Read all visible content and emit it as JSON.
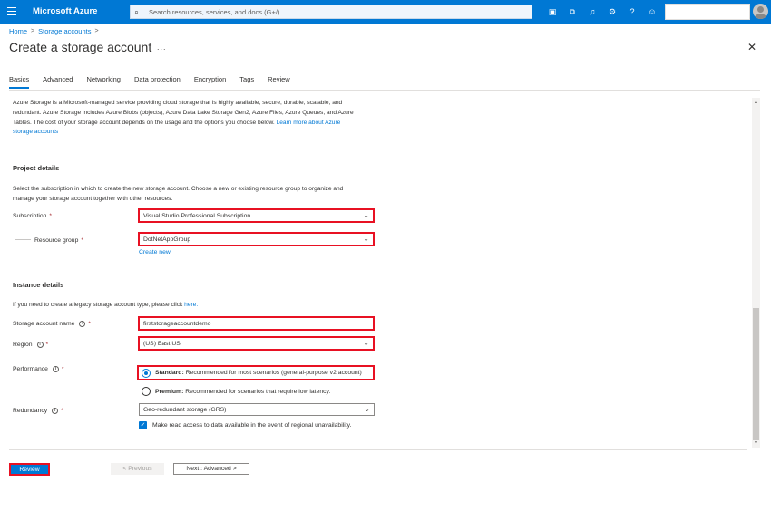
{
  "topbar": {
    "brand": "Microsoft Azure",
    "search_placeholder": "Search resources, services, and docs (G+/)",
    "icons": [
      "cloud-shell-icon",
      "directory-filter-icon",
      "bell-icon",
      "gear-icon",
      "help-icon",
      "feedback-icon"
    ]
  },
  "breadcrumb": {
    "home": "Home",
    "parent": "Storage accounts",
    "separator": ">"
  },
  "page": {
    "title": "Create a storage account",
    "more": "...",
    "close": "✕"
  },
  "tabs": [
    "Basics",
    "Advanced",
    "Networking",
    "Data protection",
    "Encryption",
    "Tags",
    "Review"
  ],
  "intro": {
    "line1": "Azure Storage is a Microsoft-managed service providing cloud storage that is highly available, secure, durable, scalable, and",
    "line2": "redundant. Azure Storage includes Azure Blobs (objects), Azure Data Lake Storage Gen2, Azure Files, Azure Queues, and Azure",
    "line3": "Tables. The cost of your storage account depends on the usage and the options you choose below.",
    "link_part1": "Learn more about Azure",
    "link_part2": "storage accounts"
  },
  "project": {
    "heading": "Project details",
    "desc1": "Select the subscription in which to create the new storage account. Choose a new or existing resource group to organize and",
    "desc2": "manage your storage account together with other resources.",
    "subscription_label": "Subscription",
    "subscription_value": "Visual Studio Professional Subscription",
    "rg_label": "Resource group",
    "rg_value": "DotNetAppGroup",
    "create_new": "Create new"
  },
  "instance": {
    "heading": "Instance details",
    "legacy_text": "If you need to create a legacy storage account type, please click",
    "legacy_link": "here.",
    "name_label": "Storage account name",
    "name_value": "firststorageaccountdemo",
    "region_label": "Region",
    "region_value": "(US) East US",
    "performance_label": "Performance",
    "standard_bold": "Standard:",
    "standard_text": "Recommended for most scenarios (general-purpose v2 account)",
    "premium_bold": "Premium:",
    "premium_text": "Recommended for scenarios that require low latency.",
    "redundancy_label": "Redundancy",
    "redundancy_value": "Geo-redundant storage (GRS)",
    "read_access_text": "Make read access to data available in the event of regional unavailability.",
    "required_mark": "*",
    "info_glyph": "i"
  },
  "footer": {
    "review": "Review",
    "previous": "< Previous",
    "next": "Next : Advanced >"
  },
  "colors": {
    "azure_blue": "#0078d4",
    "highlight_red": "#e81123"
  }
}
